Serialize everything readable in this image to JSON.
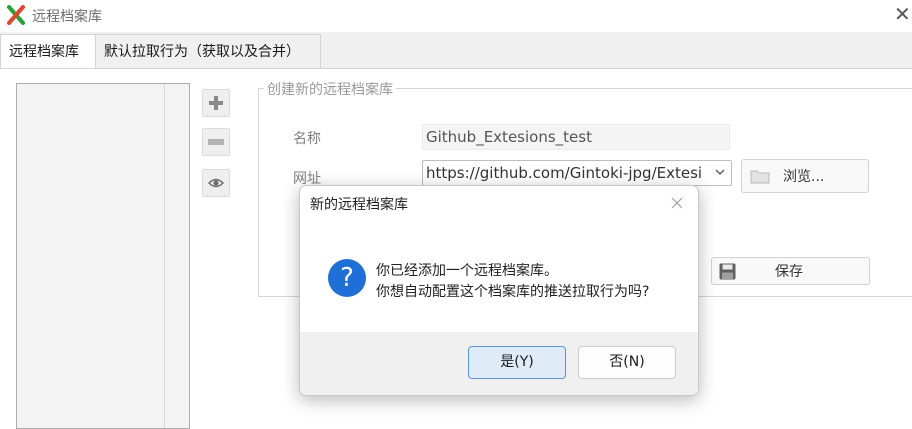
{
  "window": {
    "title": "远程档案库",
    "close_glyph": "✕"
  },
  "tabs": [
    {
      "label": "远程档案库",
      "active": true
    },
    {
      "label": "默认拉取行为（获取以及合并）",
      "active": false
    }
  ],
  "side_toolbar": {
    "add_icon": "plus-icon",
    "remove_icon": "minus-icon",
    "view_icon": "eye-icon"
  },
  "form": {
    "group_title": "创建新的远程档案库",
    "name_label": "名称",
    "name_value": "Github_Extesions_test",
    "url_label": "网址",
    "url_value": "https://github.com/Gintoki-jpg/Extesi",
    "browse_label": "浏览...",
    "save_label": "保存"
  },
  "dialog": {
    "title": "新的远程档案库",
    "icon": "question-icon",
    "icon_glyph": "?",
    "message_line1": "你已经添加一个远程档案库。",
    "message_line2": "你想自动配置这个档案库的推送拉取行为吗?",
    "yes_label": "是(Y)",
    "no_label": "否(N)"
  },
  "colors": {
    "accent": "#1e6fd8",
    "default_button_border": "#5a95d6",
    "app_icon_green": "#21a336",
    "app_icon_red": "#e2452c"
  }
}
